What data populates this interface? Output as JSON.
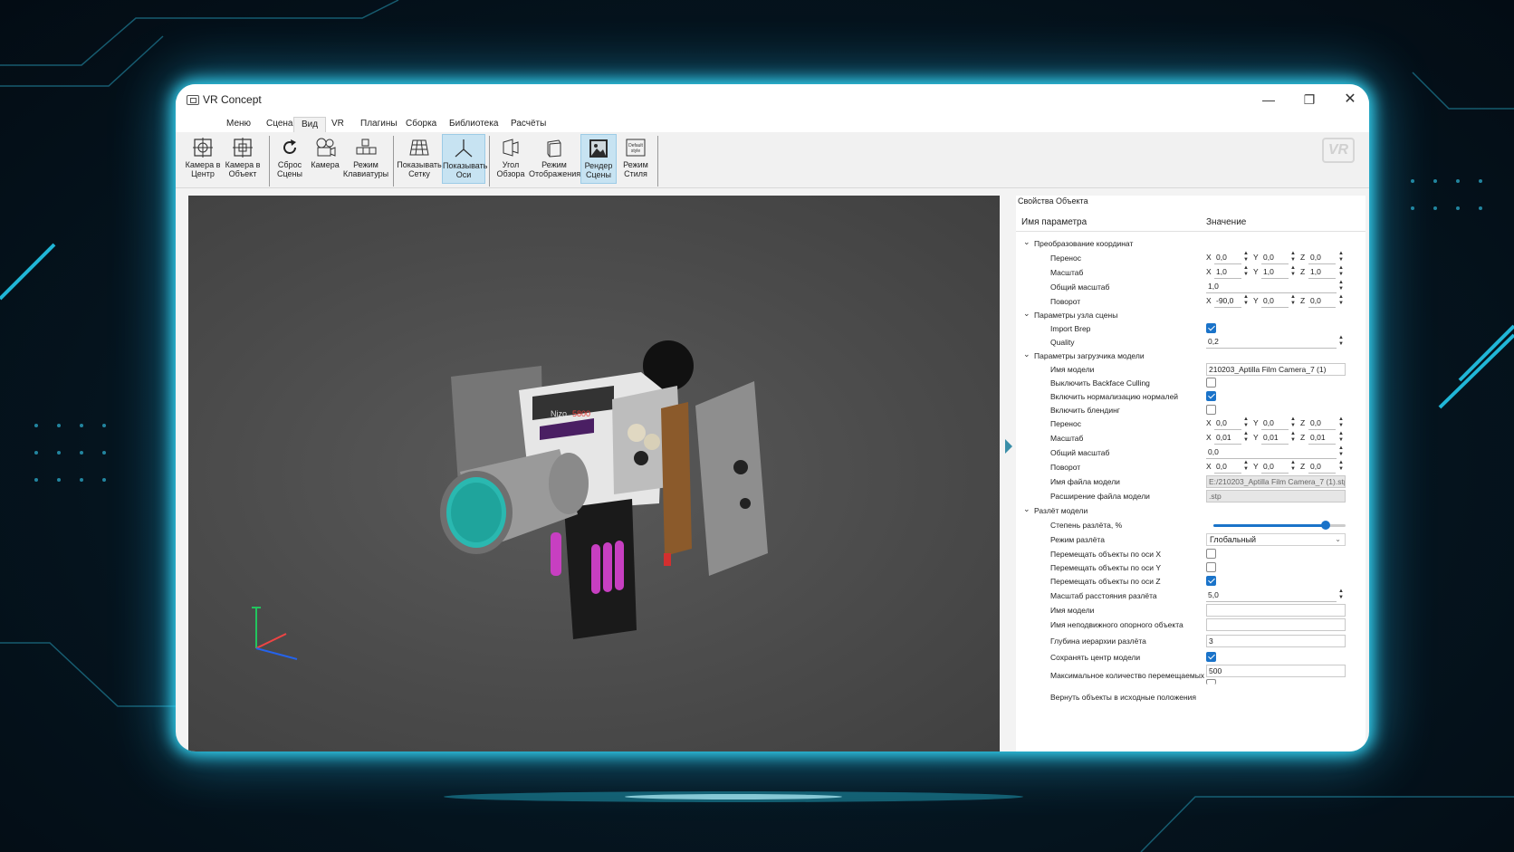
{
  "window": {
    "title": "VR Concept"
  },
  "menu_tabs": [
    "Меню",
    "Сцена",
    "Вид",
    "VR",
    "Плагины",
    "Сборка",
    "Библиотека",
    "Расчёты"
  ],
  "ribbon": {
    "camera_center": [
      "Камера в",
      "Центр"
    ],
    "camera_object": [
      "Камера в",
      "Объект"
    ],
    "reset_scene": [
      "Сброс",
      "Сцены"
    ],
    "camera": [
      "Камера",
      ""
    ],
    "keyboard_mode": [
      "Режим",
      "Клавиатуры"
    ],
    "show_grid": [
      "Показывать",
      "Сетку"
    ],
    "show_axes": [
      "Показывать",
      "Оси"
    ],
    "view_angle": [
      "Угол",
      "Обзора"
    ],
    "display_mode": [
      "Режим",
      "Отображения"
    ],
    "render_scene": [
      "Рендер",
      "Сцены"
    ],
    "style_mode": [
      "Режим",
      "Стиля"
    ],
    "style_icon_text": [
      "Default",
      "style"
    ],
    "logo": "VR"
  },
  "viewport": {
    "camera_brand": "Nizo",
    "camera_model": "5800"
  },
  "props": {
    "title": "Свойства Объекта",
    "col_name": "Имя параметра",
    "col_value": "Значение",
    "g1": "Преобразование координат",
    "translate": "Перенос",
    "scale": "Масштаб",
    "total_scale": "Общий масштаб",
    "rotate": "Поворот",
    "x": "X",
    "y": "Y",
    "z": "Z",
    "v_t1": [
      "0,0",
      "0,0",
      "0,0"
    ],
    "v_s1": [
      "1,0",
      "1,0",
      "1,0"
    ],
    "v_ts1": "1,0",
    "v_r1": [
      "-90,0",
      "0,0",
      "0,0"
    ],
    "g2": "Параметры узла сцены",
    "import_brep": "Import Brep",
    "quality": "Quality",
    "v_quality": "0,2",
    "g3": "Параметры загрузчика модели",
    "model_name": "Имя модели",
    "v_model_name": "210203_Aptilla Film Camera_7 (1)",
    "backface": "Выключить Backface Culling",
    "normals": "Включить нормализацию нормалей",
    "blending": "Включить блендинг",
    "v_t2": [
      "0,0",
      "0,0",
      "0,0"
    ],
    "v_s2": [
      "0,01",
      "0,01",
      "0,01"
    ],
    "v_ts2": "0,0",
    "v_r2": [
      "0,0",
      "0,0",
      "0,0"
    ],
    "file_name": "Имя файла модели",
    "v_file_name": "E:/210203_Aptilla Film Camera_7 (1).stp",
    "file_ext": "Расширение файла модели",
    "v_file_ext": ".stp",
    "g4": "Разлёт модели",
    "explode_degree": "Степень разлёта, %",
    "explode_value": 0.85,
    "explode_mode": "Режим разлёта",
    "v_explode_mode": "Глобальный",
    "move_x": "Перемещать объекты по оси X",
    "move_y": "Перемещать объекты по оси Y",
    "move_z": "Перемещать объекты по оси Z",
    "explode_scale": "Масштаб расстояния разлёта",
    "v_explode_scale": "5,0",
    "model_name2": "Имя модели",
    "fixed_obj": "Имя неподвижного опорного объекта",
    "depth": "Глубина иерархии разлёта",
    "v_depth": "3",
    "keep_center": "Сохранять центр модели",
    "max_objects": "Максимальное количество перемещаемых о",
    "v_max_objects": "500",
    "restore": "Вернуть объекты в исходные положения"
  },
  "colors": {
    "accent": "#1a73c9",
    "glow": "#37e0ff",
    "viewport": "#4a4a4a"
  }
}
